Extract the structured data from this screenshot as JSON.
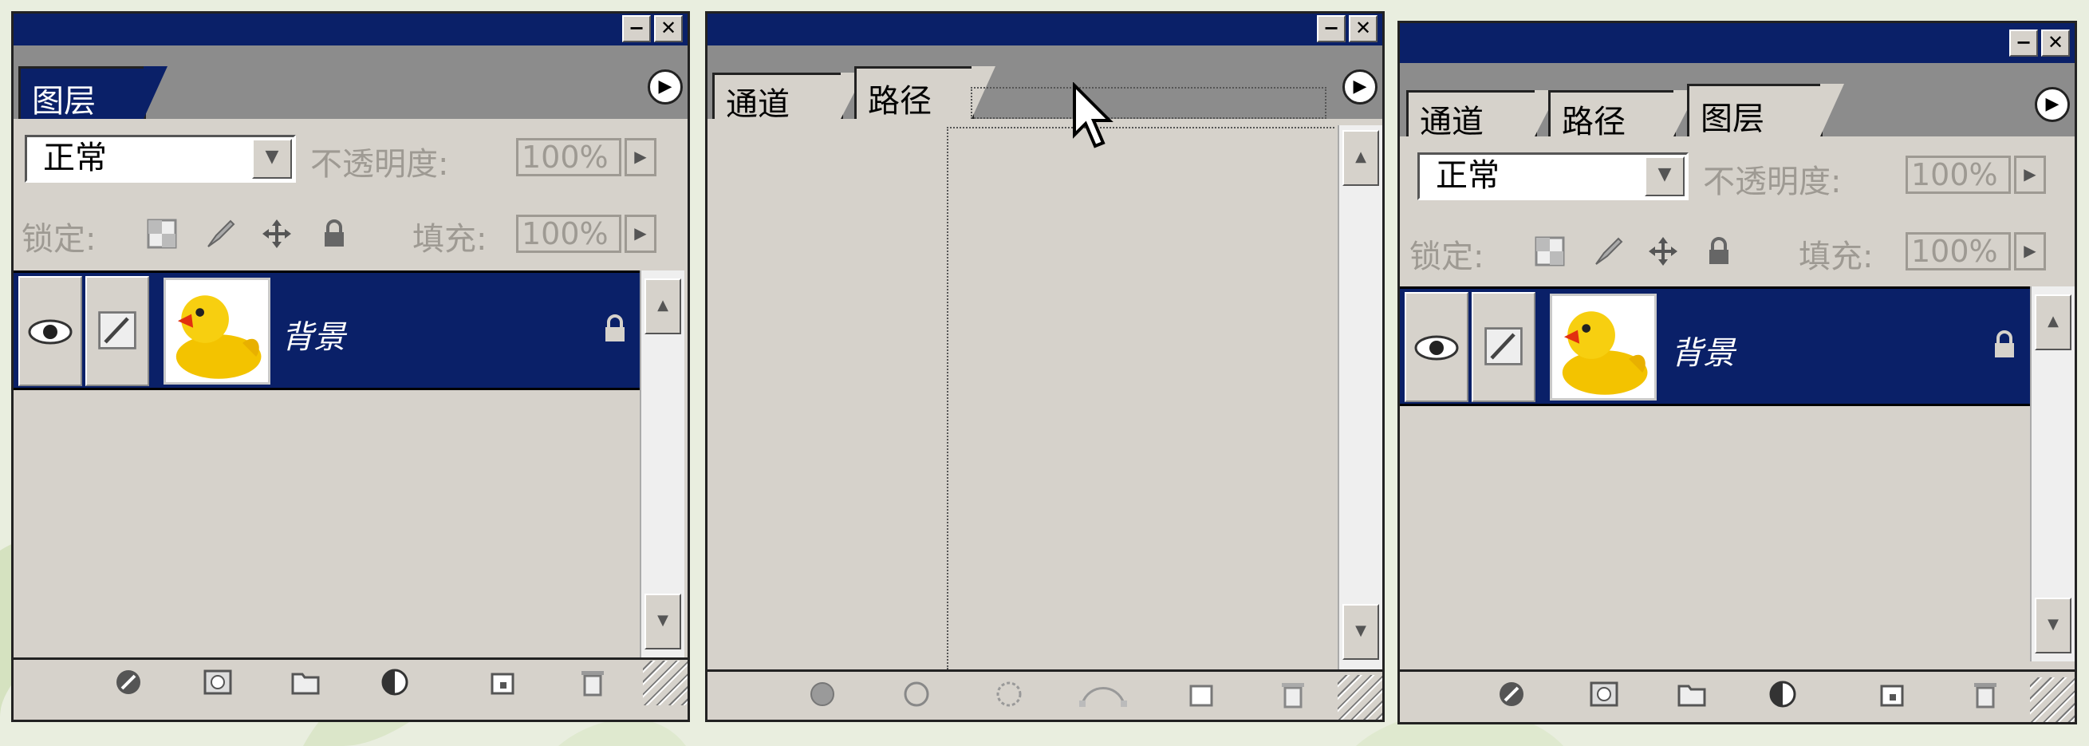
{
  "colors": {
    "titlebar": "#0a2068",
    "panel": "#d6d2cb",
    "selected_row": "#0a2068",
    "disabled_text": "#9e9a93"
  },
  "window_buttons": {
    "minimize": "−",
    "close": "✕"
  },
  "panel1": {
    "tabs": [
      {
        "label": "图层",
        "active": true
      }
    ],
    "blend_mode": "正常",
    "opacity_label": "不透明度:",
    "opacity_value": "100%",
    "lock_label": "锁定:",
    "fill_label": "填充:",
    "fill_value": "100%",
    "layer": {
      "name": "背景",
      "locked": true,
      "visible": true
    },
    "bottom_icons": [
      "layer-style-icon",
      "layer-mask-icon",
      "new-group-icon",
      "adjustment-layer-icon",
      "new-layer-icon",
      "trash-icon"
    ]
  },
  "panel2": {
    "tabs": [
      {
        "label": "通道",
        "active": false
      },
      {
        "label": "路径",
        "active": true
      }
    ],
    "bottom_icons": [
      "fill-path-icon",
      "stroke-path-icon",
      "load-selection-icon",
      "make-work-path-icon",
      "new-path-icon",
      "trash-icon"
    ]
  },
  "panel3": {
    "tabs": [
      {
        "label": "通道",
        "active": false
      },
      {
        "label": "路径",
        "active": false
      },
      {
        "label": "图层",
        "active": true
      }
    ],
    "blend_mode": "正常",
    "opacity_label": "不透明度:",
    "opacity_value": "100%",
    "lock_label": "锁定:",
    "fill_label": "填充:",
    "fill_value": "100%",
    "layer": {
      "name": "背景",
      "locked": true,
      "visible": true
    },
    "bottom_icons": [
      "layer-style-icon",
      "layer-mask-icon",
      "new-group-icon",
      "adjustment-layer-icon",
      "new-layer-icon",
      "trash-icon"
    ]
  }
}
